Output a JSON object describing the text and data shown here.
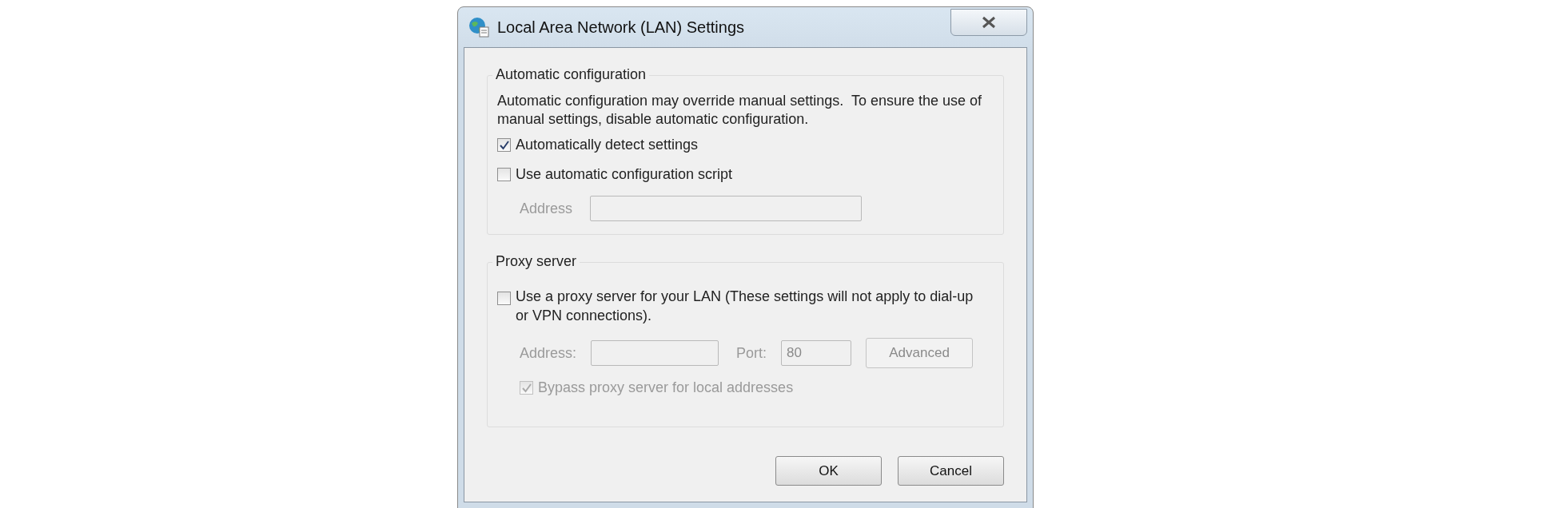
{
  "window": {
    "title": "Local Area Network (LAN) Settings"
  },
  "automatic_configuration": {
    "title": "Automatic configuration",
    "description": "Automatic configuration may override manual settings.  To ensure the use of manual settings, disable automatic configuration.",
    "options": [
      {
        "label": "Automatically detect settings",
        "checked": true,
        "disabled": false
      },
      {
        "label": "Use automatic configuration script",
        "checked": false,
        "disabled": false
      }
    ],
    "address": {
      "label": "Address",
      "disabled": true
    }
  },
  "proxy_server": {
    "title": "Proxy server",
    "use_proxy": {
      "label": "Use a proxy server for your LAN (These settings will not apply to dial-up or VPN connections).",
      "checked": false,
      "disabled": false
    },
    "address": {
      "label": "Address:",
      "disabled": true
    },
    "port": {
      "label": "Port:",
      "value": "80",
      "disabled": true
    },
    "advanced": {
      "label": "Advanced",
      "disabled": true
    },
    "bypass": {
      "label": "Bypass proxy server for local addresses",
      "checked": true,
      "disabled": true
    }
  },
  "buttons": [
    "OK",
    "Cancel"
  ]
}
